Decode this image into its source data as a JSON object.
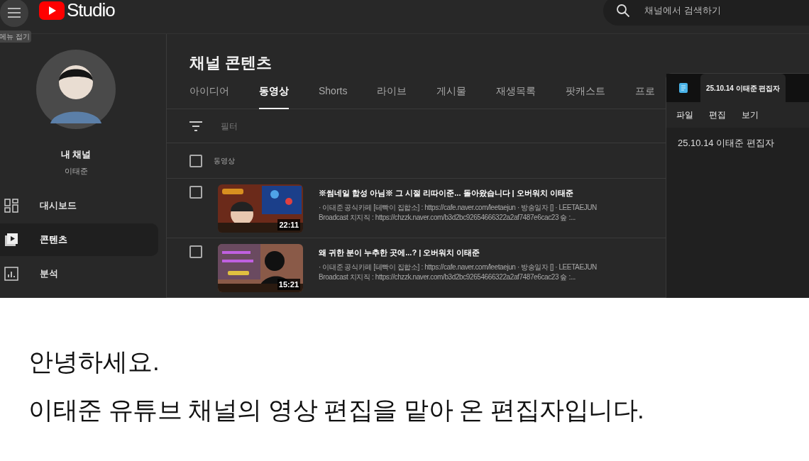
{
  "top_bar": {
    "menu_tooltip": "메뉴 접기",
    "logo_text": "Studio",
    "search": {
      "placeholder": "채널에서 검색하기"
    }
  },
  "sidebar": {
    "channel_title": "내 채널",
    "channel_name": "이태준",
    "items": [
      {
        "label": "대시보드",
        "kind": "dashboard",
        "selected": false
      },
      {
        "label": "콘텐츠",
        "kind": "content",
        "selected": true
      },
      {
        "label": "분석",
        "kind": "analytics",
        "selected": false
      }
    ]
  },
  "main": {
    "title": "채널 콘텐츠",
    "tabs": [
      {
        "label": "아이디어",
        "selected": false
      },
      {
        "label": "동영상",
        "selected": true
      },
      {
        "label": "Shorts",
        "selected": false
      },
      {
        "label": "라이브",
        "selected": false
      },
      {
        "label": "게시물",
        "selected": false
      },
      {
        "label": "재생목록",
        "selected": false
      },
      {
        "label": "팟캐스트",
        "selected": false
      },
      {
        "label": "프로",
        "selected": false
      }
    ],
    "filter": {
      "placeholder": "필터"
    },
    "table": {
      "header": {
        "label": "동영상",
        "checked": false
      },
      "rows": [
        {
          "title": "※썸네일 합성 아님※ 그 시절 리따이준... 돌아왔습니다 | 오버워치 이태준",
          "description": [
            "· 이태준 공식카페 [테빡이 집합소] : https://cafe.naver.com/leetaejun · 방송일자 [] · LEETAEJUN",
            "Broadcast 치지직 : https://chzzk.naver.com/b3d2bc92654666322a2af7487e6cac23 숲 :..."
          ],
          "duration": "22:11",
          "checked": false
        },
        {
          "title": "왜 귀한 분이 누추한 곳에...? | 오버워치 이태준",
          "description": [
            "· 이태준 공식카페 [테빡이 집합소] : https://cafe.naver.com/leetaejun · 방송일자 [] · LEETAEJUN",
            "Broadcast 치지직 : https://chzzk.naver.com/b3d2bc92654666322a2af7487e6cac23 숲 :..."
          ],
          "duration": "15:21",
          "checked": false
        }
      ]
    }
  },
  "notepad": {
    "tab_title": "25.10.14 이태준 편집자",
    "menu": [
      "파일",
      "편집",
      "보기"
    ],
    "content": "25.10.14 이태준 편집자"
  },
  "caption": [
    "안녕하세요.",
    "이태준 유튜브 채널의 영상 편집을 맡아 온 편집자입니다."
  ]
}
